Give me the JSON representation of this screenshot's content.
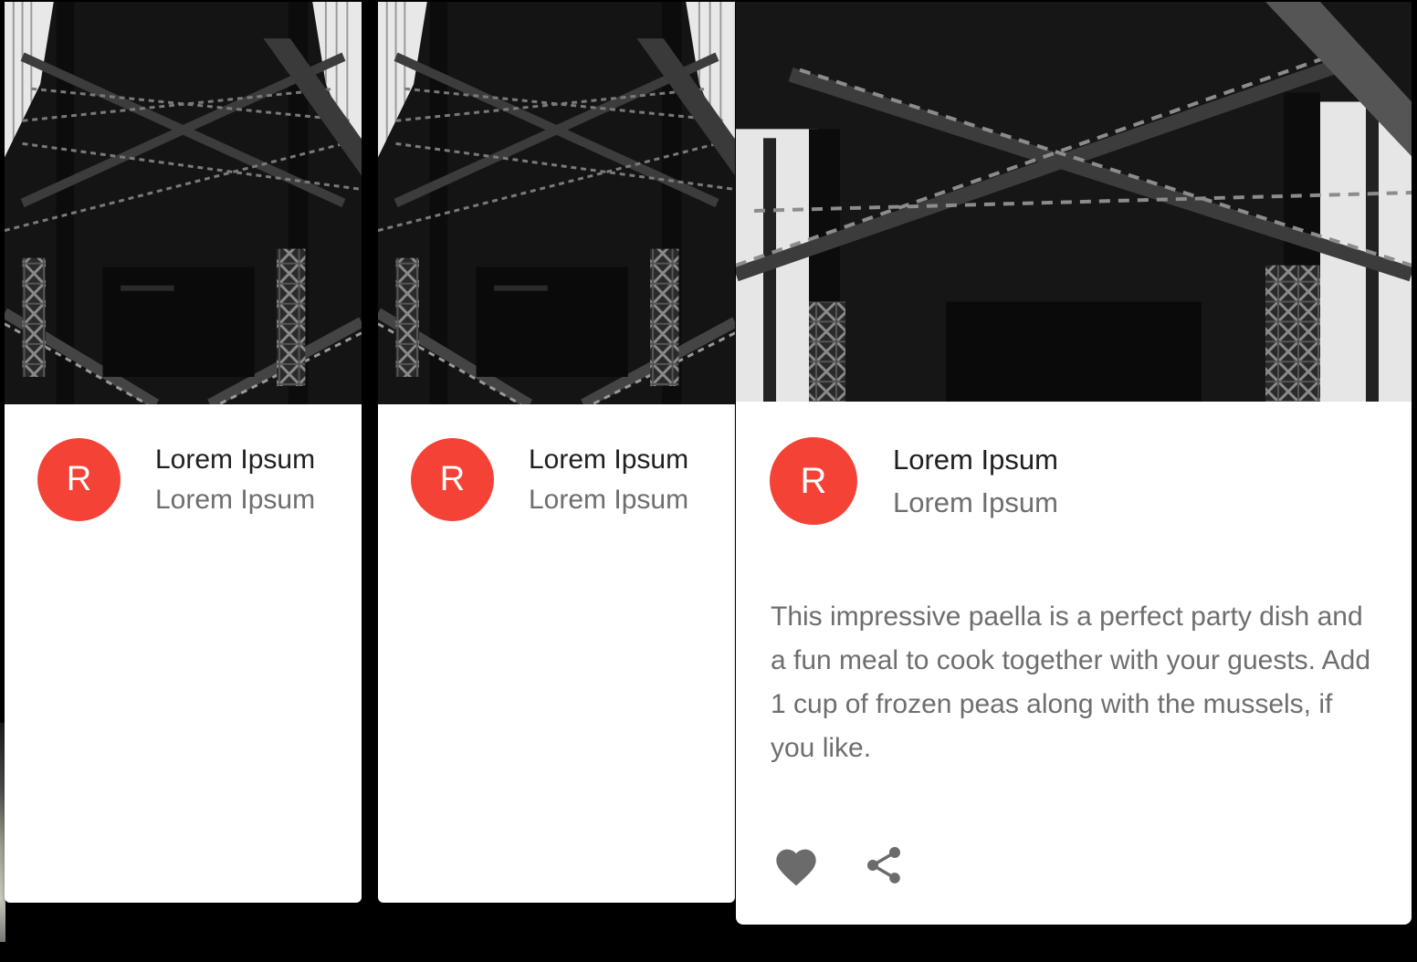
{
  "cards": [
    {
      "avatar_letter": "R",
      "title": "Lorem Ipsum",
      "subheader": "Lorem Ipsum",
      "image_icon": "bridge-truss-photo"
    },
    {
      "avatar_letter": "R",
      "title": "Lorem Ipsum",
      "subheader": "Lorem Ipsum",
      "image_icon": "bridge-truss-photo"
    },
    {
      "avatar_letter": "R",
      "title": "Lorem Ipsum",
      "subheader": "Lorem Ipsum",
      "image_icon": "bridge-truss-photo",
      "body": "This impressive paella is a perfect party dish and a fun meal to cook together with your guests. Add 1 cup of frozen peas along with the mussels, if you like.",
      "actions": [
        {
          "icon": "heart-icon",
          "label": "Add to favorites"
        },
        {
          "icon": "share-icon",
          "label": "Share"
        }
      ]
    }
  ],
  "colors": {
    "avatar": "#f44336",
    "title": "#1f1f1f",
    "secondary_text": "#6e6e6e",
    "icon": "#6b6b6b",
    "background": "#000000",
    "card": "#ffffff"
  }
}
